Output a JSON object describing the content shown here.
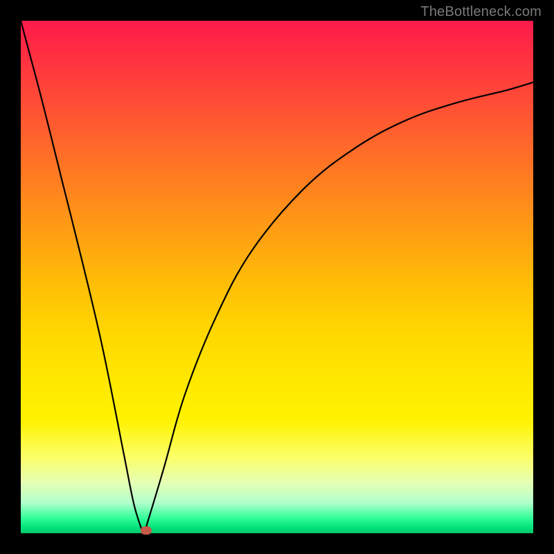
{
  "watermark": "TheBottleneck.com",
  "colors": {
    "marker": "#c65a4a",
    "curve": "#000000",
    "frame": "#000000"
  },
  "chart_data": {
    "type": "line",
    "title": "",
    "xlabel": "",
    "ylabel": "",
    "xlim": [
      0,
      100
    ],
    "ylim": [
      0,
      100
    ],
    "grid": false,
    "legend": false,
    "notes": "Bottleneck-style curve: steep V dipping to ~0 near x≈24, then asymptotically rising toward ~88 at the right edge. Background is a vertical spectral gradient red→yellow→green. Values are read from geometry; no axis ticks are visible.",
    "series": [
      {
        "name": "bottleneck-curve",
        "x": [
          0,
          4,
          8,
          12,
          16,
          20,
          22,
          23.5,
          24,
          25,
          28,
          32,
          38,
          45,
          55,
          65,
          75,
          85,
          95,
          100
        ],
        "values": [
          100,
          85,
          69,
          53,
          36,
          16,
          6,
          1,
          0,
          3,
          13,
          27,
          42,
          55,
          67,
          75,
          80.5,
          84,
          86.5,
          88
        ]
      }
    ],
    "marker": {
      "x": 24.5,
      "y": 0.5
    }
  }
}
